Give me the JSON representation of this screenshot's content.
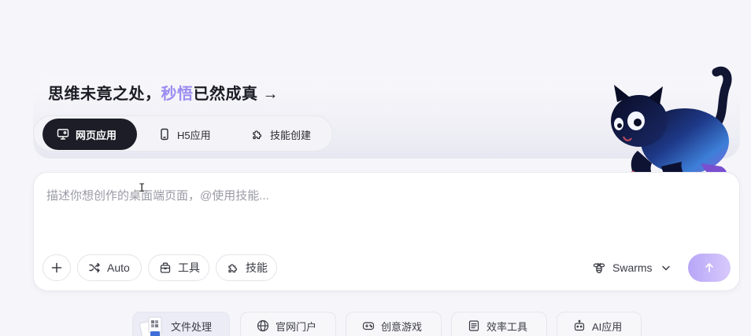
{
  "hero": {
    "slogan_prefix": "思维未竟之处，",
    "slogan_accent": "秒悟",
    "slogan_suffix": "已然成真 →"
  },
  "mode_tabs": [
    {
      "label": "网页应用",
      "icon": "monitor-icon",
      "active": true
    },
    {
      "label": "H5应用",
      "icon": "mobile-icon",
      "active": false
    },
    {
      "label": "技能创建",
      "icon": "puzzle-icon",
      "active": false
    }
  ],
  "composer": {
    "placeholder": "描述你想创作的桌面端页面，@使用技能...",
    "auto_label": "Auto",
    "tools_label": "工具",
    "skills_label": "技能",
    "model_label": "Swarms"
  },
  "categories": [
    {
      "label": "文件处理",
      "icon": "file-thumbnail"
    },
    {
      "label": "官网门户",
      "icon": "globe-icon"
    },
    {
      "label": "创意游戏",
      "icon": "gamepad-icon"
    },
    {
      "label": "效率工具",
      "icon": "document-icon"
    },
    {
      "label": "AI应用",
      "icon": "robot-icon"
    }
  ],
  "colors": {
    "accent": "#9b8cf0",
    "active_tab": "#1c1d27",
    "send_gradient_start": "#b7a6f8",
    "send_gradient_end": "#d8c9fb"
  }
}
